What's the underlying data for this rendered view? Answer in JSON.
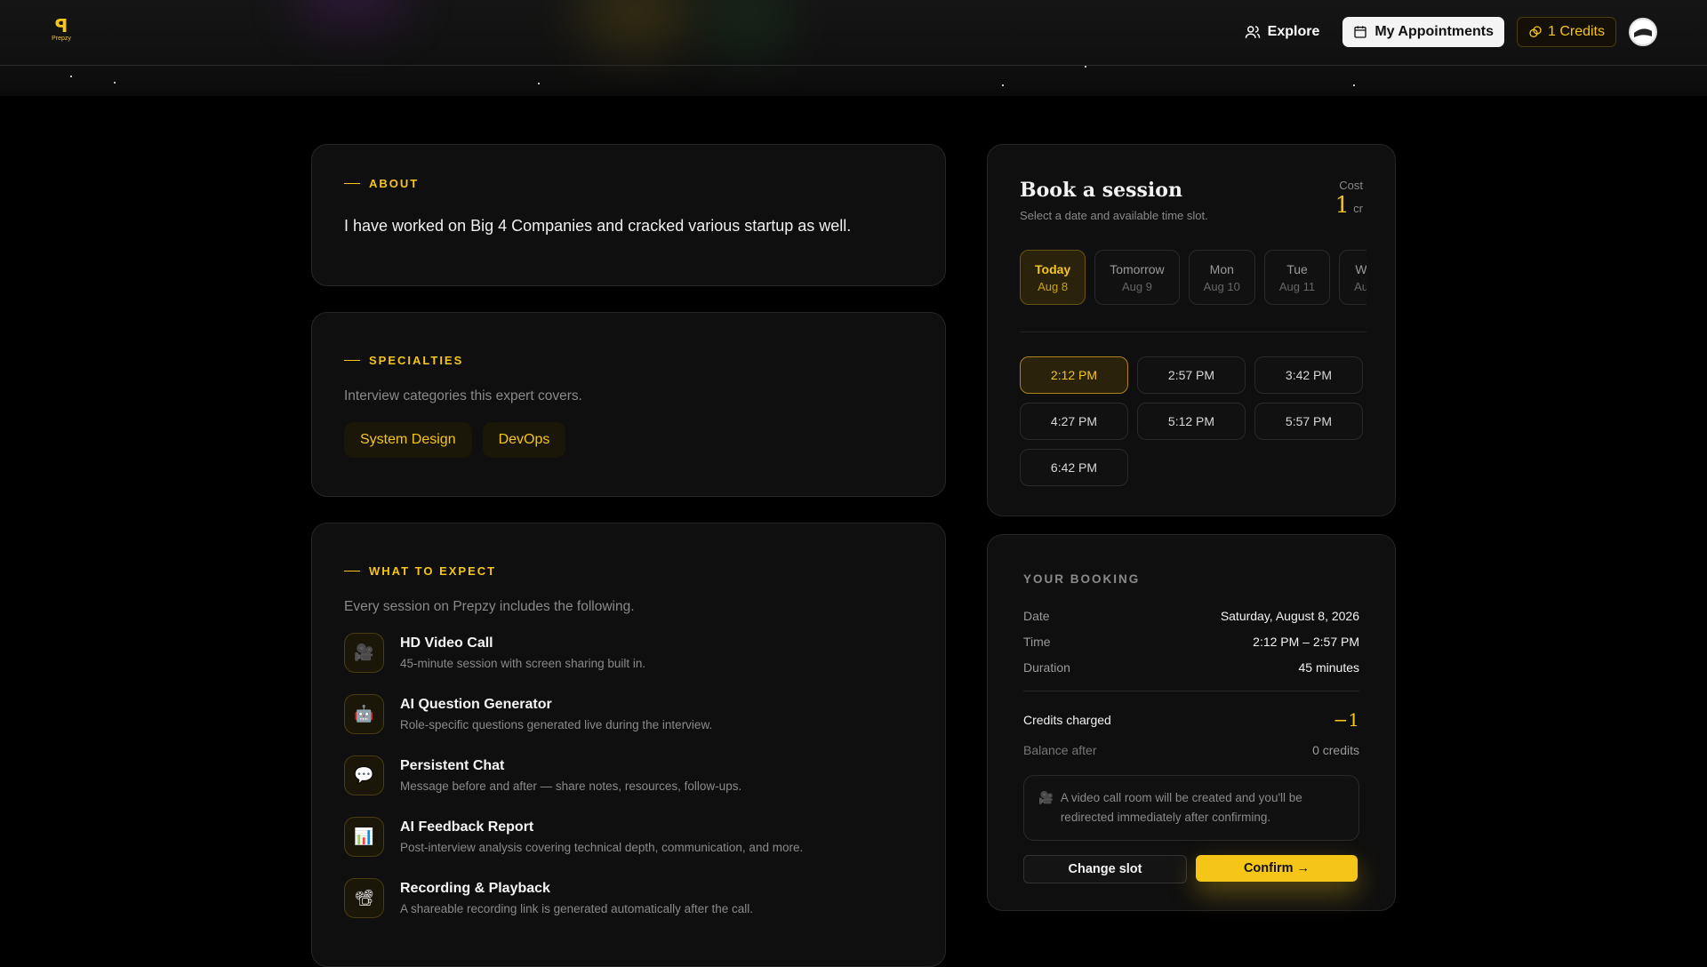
{
  "brand": {
    "logo_word": "Prepzy"
  },
  "nav": {
    "explore": "Explore",
    "appointments": "My Appointments",
    "credits": "1 Credits"
  },
  "about": {
    "label": "ABOUT",
    "text": "I have worked on Big 4 Companies and cracked various startup as well."
  },
  "specialties": {
    "label": "SPECIALTIES",
    "subtitle": "Interview categories this expert covers.",
    "chips": [
      "System Design",
      "DevOps"
    ]
  },
  "expect": {
    "label": "WHAT TO EXPECT",
    "subtitle": "Every session on Prepzy includes the following.",
    "items": [
      {
        "icon": "video-camera-icon",
        "glyph": "🎥",
        "title": "HD Video Call",
        "desc": "45-minute session with screen sharing built in."
      },
      {
        "icon": "robot-icon",
        "glyph": "🤖",
        "title": "AI Question Generator",
        "desc": "Role-specific questions generated live during the interview."
      },
      {
        "icon": "chat-bubble-icon",
        "glyph": "💬",
        "title": "Persistent Chat",
        "desc": "Message before and after — share notes, resources, follow-ups."
      },
      {
        "icon": "bar-chart-icon",
        "glyph": "📊",
        "title": "AI Feedback Report",
        "desc": "Post-interview analysis covering technical depth, communication, and more."
      },
      {
        "icon": "film-icon",
        "glyph": "📽",
        "title": "Recording & Playback",
        "desc": "A shareable recording link is generated automatically after the call."
      }
    ]
  },
  "book": {
    "title": "Book a session",
    "subtitle": "Select a date and available time slot.",
    "cost_label": "Cost",
    "cost_value": "1",
    "cost_unit": "cr",
    "dates": [
      {
        "day": "Today",
        "date": "Aug 8",
        "active": true
      },
      {
        "day": "Tomorrow",
        "date": "Aug 9",
        "active": false
      },
      {
        "day": "Mon",
        "date": "Aug 10",
        "active": false
      },
      {
        "day": "Tue",
        "date": "Aug 11",
        "active": false
      },
      {
        "day": "We",
        "date": "Aug",
        "active": false
      }
    ],
    "slots": [
      {
        "time": "2:12 PM",
        "active": true
      },
      {
        "time": "2:57 PM",
        "active": false
      },
      {
        "time": "3:42 PM",
        "active": false
      },
      {
        "time": "4:27 PM",
        "active": false
      },
      {
        "time": "5:12 PM",
        "active": false
      },
      {
        "time": "5:57 PM",
        "active": false
      },
      {
        "time": "6:42 PM",
        "active": false
      }
    ]
  },
  "booking": {
    "label": "YOUR BOOKING",
    "date_key": "Date",
    "date_val": "Saturday, August 8, 2026",
    "time_key": "Time",
    "time_val": "2:12 PM – 2:57 PM",
    "duration_key": "Duration",
    "duration_val": "45 minutes",
    "credits_key": "Credits charged",
    "credits_val": "−1",
    "balance_key": "Balance after",
    "balance_val": "0 credits",
    "notice_glyph": "🎥",
    "notice": "A video call room will be created and you'll be redirected immediately after confirming.",
    "change_btn": "Change slot",
    "confirm_btn": "Confirm →"
  },
  "colors": {
    "accent": "#f5c518",
    "background": "#000000",
    "card": "#0f0f0f"
  }
}
